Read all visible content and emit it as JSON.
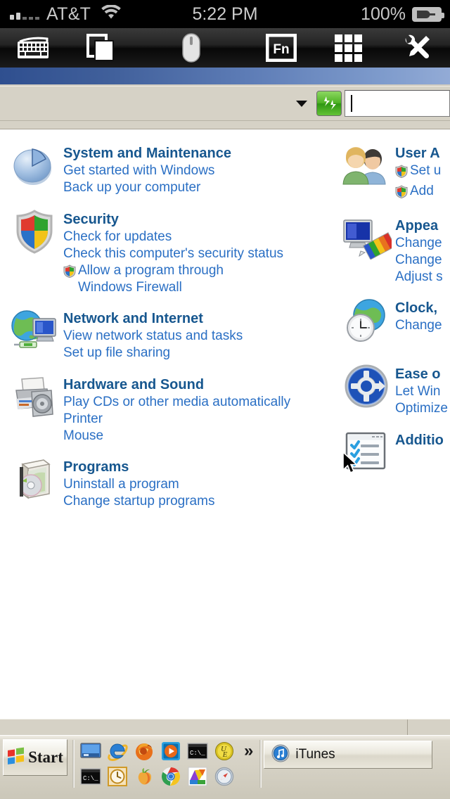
{
  "ios_status": {
    "carrier": "AT&T",
    "signal_bars_filled": 2,
    "signal_bars_total": 5,
    "time": "5:22 PM",
    "battery_percent": "100%",
    "battery_state": "charging"
  },
  "app_toolbar": {
    "buttons": [
      {
        "name": "keyboard-icon",
        "label": "Keyboard"
      },
      {
        "name": "windows-icon",
        "label": "Windows"
      },
      {
        "name": "mouse-icon",
        "label": "Mouse"
      },
      {
        "name": "fn-icon",
        "label": "Fn"
      },
      {
        "name": "numpad-icon",
        "label": "Numpad"
      },
      {
        "name": "tools-icon",
        "label": "Tools"
      }
    ]
  },
  "remote": {
    "address_bar": {
      "dropdown_label": "",
      "refresh_label": "Refresh",
      "search_value": "",
      "search_placeholder": ""
    },
    "control_panel": {
      "left_column": [
        {
          "icon": "system-maintenance-icon",
          "title": "System and Maintenance",
          "links": [
            {
              "text": "Get started with Windows",
              "shield": false
            },
            {
              "text": "Back up your computer",
              "shield": false
            }
          ]
        },
        {
          "icon": "security-shield-icon",
          "title": "Security",
          "links": [
            {
              "text": "Check for updates",
              "shield": false
            },
            {
              "text": "Check this computer's security status",
              "shield": false
            },
            {
              "text": "Allow a program through Windows Firewall",
              "shield": true
            }
          ]
        },
        {
          "icon": "network-internet-icon",
          "title": "Network and Internet",
          "links": [
            {
              "text": "View network status and tasks",
              "shield": false
            },
            {
              "text": "Set up file sharing",
              "shield": false
            }
          ]
        },
        {
          "icon": "hardware-sound-icon",
          "title": "Hardware and Sound",
          "links": [
            {
              "text": "Play CDs or other media automatically",
              "shield": false
            },
            {
              "text": "Printer",
              "shield": false
            },
            {
              "text": "Mouse",
              "shield": false
            }
          ]
        },
        {
          "icon": "programs-icon",
          "title": "Programs",
          "links": [
            {
              "text": "Uninstall a program",
              "shield": false
            },
            {
              "text": "Change startup programs",
              "shield": false
            }
          ]
        }
      ],
      "right_column": [
        {
          "icon": "user-accounts-icon",
          "title": "User A",
          "links": [
            {
              "text": "Set u",
              "shield": true
            },
            {
              "text": "Add",
              "shield": true
            }
          ]
        },
        {
          "icon": "appearance-icon",
          "title": "Appea",
          "links": [
            {
              "text": "Change",
              "shield": false
            },
            {
              "text": "Change",
              "shield": false
            },
            {
              "text": "Adjust s",
              "shield": false
            }
          ]
        },
        {
          "icon": "clock-language-region-icon",
          "title": "Clock,",
          "links": [
            {
              "text": "Change",
              "shield": false
            }
          ]
        },
        {
          "icon": "ease-of-access-icon",
          "title": "Ease o",
          "links": [
            {
              "text": "Let Win",
              "shield": false
            },
            {
              "text": "Optimize",
              "shield": false
            }
          ]
        },
        {
          "icon": "additional-options-icon",
          "title": "Additio",
          "links": []
        }
      ]
    },
    "taskbar": {
      "start_label": "Start",
      "quick_launch_row1": [
        {
          "name": "show-desktop-icon",
          "label": "Show Desktop"
        },
        {
          "name": "internet-explorer-icon",
          "label": "Internet Explorer"
        },
        {
          "name": "firefox-icon",
          "label": "Mozilla Firefox"
        },
        {
          "name": "media-player-icon",
          "label": "Windows Media Player"
        },
        {
          "name": "command-prompt-icon",
          "label": "Command Prompt"
        },
        {
          "name": "ultraedit-icon",
          "label": "UltraEdit"
        }
      ],
      "quick_launch_row2": [
        {
          "name": "command-prompt-icon",
          "label": "Command Prompt"
        },
        {
          "name": "clock-app-icon",
          "label": "Clock"
        },
        {
          "name": "peach-app-icon",
          "label": "Peach"
        },
        {
          "name": "chrome-icon",
          "label": "Google Chrome"
        },
        {
          "name": "picasa-icon",
          "label": "Picasa"
        },
        {
          "name": "safari-icon",
          "label": "Safari"
        }
      ],
      "more_chevron": "»",
      "task_buttons": [
        {
          "name": "itunes-task-button",
          "icon": "itunes-icon",
          "label": "iTunes"
        }
      ]
    }
  },
  "colors": {
    "heading": "#17578f",
    "link": "#2a6fc4",
    "taskbar": "#d4d0c3",
    "titlebar_left": "#2f4f8f",
    "titlebar_right": "#93abd6",
    "refresh_green": "#4fb226"
  }
}
